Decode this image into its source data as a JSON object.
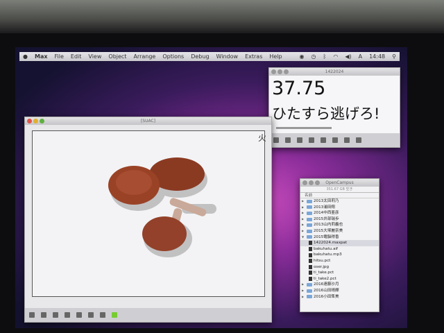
{
  "menubar": {
    "items": [
      "Max",
      "File",
      "Edit",
      "View",
      "Object",
      "Arrange",
      "Options",
      "Debug",
      "Window",
      "Extras",
      "Help"
    ],
    "clock": "14:48"
  },
  "main_window": {
    "title": "[SUAC]"
  },
  "number_window": {
    "title": "1422024",
    "value": "37.75",
    "message": "ひたすら逃げろ!"
  },
  "finder": {
    "title": "OpenCampus",
    "subtitle": "351.67 GB 空き",
    "column": "名前",
    "items": [
      {
        "label": "2013太田莉乃",
        "type": "folder"
      },
      {
        "label": "2013浦田翔",
        "type": "folder"
      },
      {
        "label": "2014中西亜彦",
        "type": "folder"
      },
      {
        "label": "2015井部瑞歩",
        "type": "folder"
      },
      {
        "label": "2013山内莉義也",
        "type": "folder"
      },
      {
        "label": "2015大塚麗奈美",
        "type": "folder"
      },
      {
        "label": "2015電脳得香",
        "type": "folder",
        "open": true
      },
      {
        "label": "1422024.maxpat",
        "type": "file",
        "child": true,
        "selected": true
      },
      {
        "label": "bakuhatu.aif",
        "type": "file",
        "child": true
      },
      {
        "label": "bakuhatu.mp3",
        "type": "file",
        "child": true
      },
      {
        "label": "hitsu.pct",
        "type": "file",
        "child": true
      },
      {
        "label": "oser.jpg",
        "type": "file",
        "child": true
      },
      {
        "label": "ti_take.pct",
        "type": "file",
        "child": true
      },
      {
        "label": "ti_take2.pct",
        "type": "file",
        "child": true
      },
      {
        "label": "2016遠藤沙月",
        "type": "folder"
      },
      {
        "label": "2016山田晴輝",
        "type": "folder"
      },
      {
        "label": "2016小田隼美",
        "type": "folder"
      }
    ]
  }
}
